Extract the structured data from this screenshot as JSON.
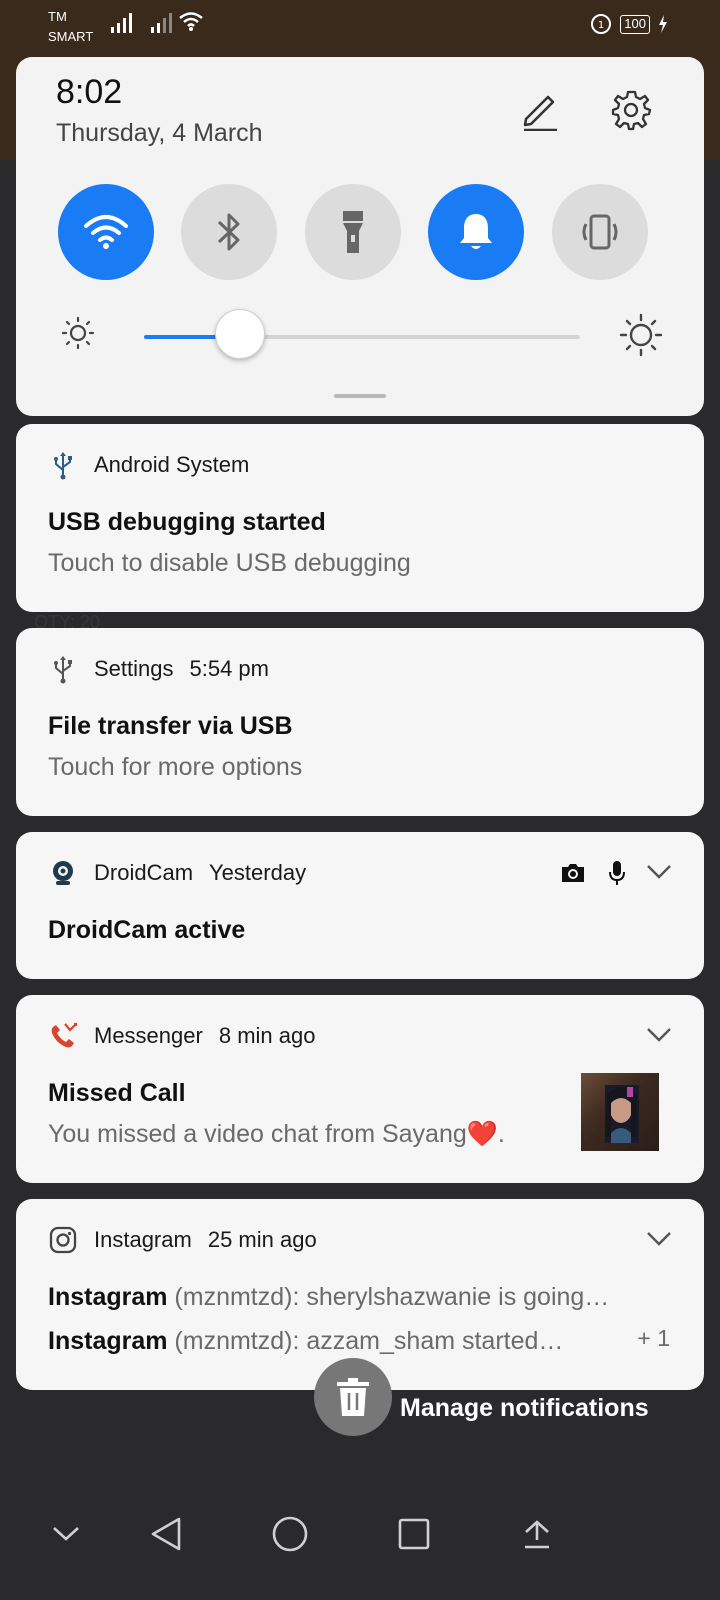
{
  "status_bar": {
    "carrier_line1": "TM",
    "carrier_line2": "SMART",
    "battery": "100"
  },
  "quick_settings": {
    "time": "8:02",
    "date": "Thursday, 4 March",
    "tiles": [
      {
        "name": "wifi",
        "state": "on"
      },
      {
        "name": "bluetooth",
        "state": "off"
      },
      {
        "name": "flashlight",
        "state": "off"
      },
      {
        "name": "sound",
        "state": "on"
      },
      {
        "name": "vibrate",
        "state": "off"
      }
    ],
    "brightness": 0.22,
    "accent": "#1a7cf5"
  },
  "notifications": [
    {
      "app": "Android System",
      "time": "",
      "icon": "usb-icon",
      "title": "USB debugging started",
      "body": "Touch to disable USB debugging"
    },
    {
      "app": "Settings",
      "time": "5:54 pm",
      "icon": "usb-icon",
      "title": "File transfer via USB",
      "body": "Touch for more options"
    },
    {
      "app": "DroidCam",
      "time": "Yesterday",
      "icon": "webcam-icon",
      "title": "DroidCam active",
      "actions": [
        "camera-icon",
        "mic-icon"
      ]
    },
    {
      "app": "Messenger",
      "time": "8 min ago",
      "icon": "missed-call-icon",
      "title": "Missed Call",
      "body": "You missed a video chat from Sayang❤️."
    },
    {
      "app": "Instagram",
      "time": "25 min ago",
      "icon": "instagram-icon",
      "lines": [
        {
          "sender": "Instagram",
          "text": " (mznmtzd): sherylshazwanie is going…"
        },
        {
          "sender": "Instagram",
          "text": " (mznmtzd): azzam_sham started…"
        }
      ],
      "more": "+ 1"
    }
  ],
  "manage_notifications": "Manage notifications"
}
